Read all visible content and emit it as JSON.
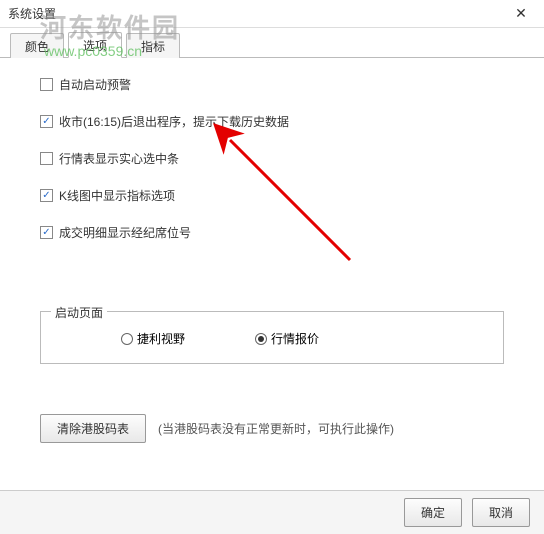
{
  "window": {
    "title": "系统设置"
  },
  "watermark": {
    "line1": "河东软件园",
    "line2": "www.pc0359.cn"
  },
  "tabs": [
    {
      "label": "颜色",
      "active": false
    },
    {
      "label": "选项",
      "active": true
    },
    {
      "label": "指标",
      "active": false
    }
  ],
  "checkboxes": [
    {
      "label": "自动启动预警",
      "checked": false
    },
    {
      "label": "收市(16:15)后退出程序，提示下载历史数据",
      "checked": true
    },
    {
      "label": "行情表显示实心选中条",
      "checked": false
    },
    {
      "label": "K线图中显示指标选项",
      "checked": true
    },
    {
      "label": "成交明细显示经纪席位号",
      "checked": true
    }
  ],
  "startup": {
    "legend": "启动页面",
    "options": [
      {
        "label": "捷利视野",
        "selected": false
      },
      {
        "label": "行情报价",
        "selected": true
      }
    ]
  },
  "clear": {
    "button": "清除港股码表",
    "hint": "(当港股码表没有正常更新时，可执行此操作)"
  },
  "footer": {
    "ok": "确定",
    "cancel": "取消"
  }
}
